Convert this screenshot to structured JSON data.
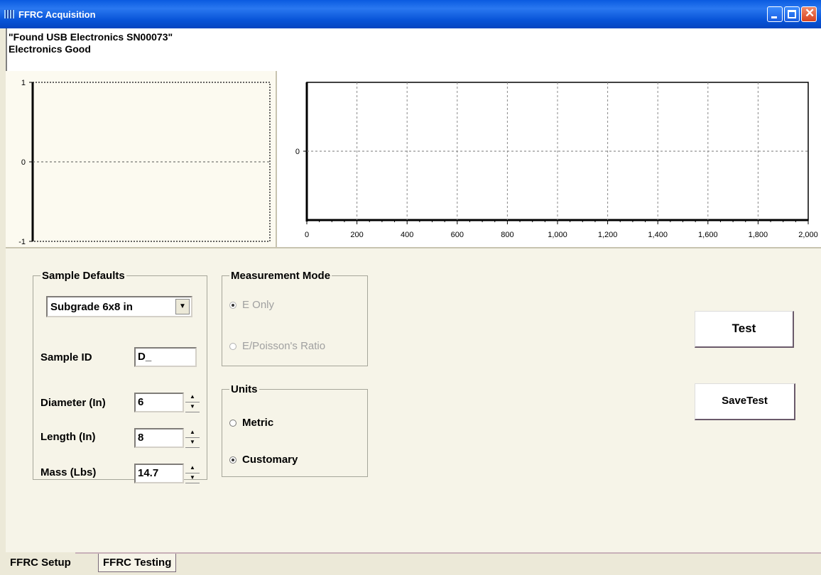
{
  "window": {
    "title": "FFRC Acquisition"
  },
  "status": {
    "line1": "\"Found USB Electronics SN00073\"",
    "line2": "Electronics Good"
  },
  "chart_data": [
    {
      "type": "line",
      "y_ticks": [
        "1",
        "0",
        "-1"
      ],
      "ylim": [
        -1,
        1
      ],
      "grid": "horizontal dashed at 0",
      "series": []
    },
    {
      "type": "line",
      "x_ticks": [
        "0",
        "200",
        "400",
        "600",
        "800",
        "1,000",
        "1,200",
        "1,400",
        "1,600",
        "1,800",
        "2,000"
      ],
      "xlim": [
        0,
        2000
      ],
      "y_ticks": [
        "0"
      ],
      "grid": "vertical dashed at each x tick, horizontal dashed at 0",
      "series": []
    }
  ],
  "sample_defaults": {
    "legend": "Sample Defaults",
    "preset_value": "Subgrade 6x8 in",
    "sample_id_label": "Sample ID",
    "sample_id_value": "D_",
    "diameter_label": "Diameter (In)",
    "diameter_value": "6",
    "length_label": "Length (In)",
    "length_value": "8",
    "mass_label": "Mass (Lbs)",
    "mass_value": "14.7"
  },
  "measurement_mode": {
    "legend": "Measurement Mode",
    "options": [
      {
        "label": "E Only",
        "checked": true,
        "enabled": false
      },
      {
        "label": "E/Poisson's Ratio",
        "checked": false,
        "enabled": false
      }
    ]
  },
  "units": {
    "legend": "Units",
    "options": [
      {
        "label": "Metric",
        "checked": false
      },
      {
        "label": "Customary",
        "checked": true
      }
    ]
  },
  "buttons": {
    "test": "Test",
    "save_test": "SaveTest"
  },
  "tabs": [
    {
      "label": "FFRC Setup",
      "active": true
    },
    {
      "label": "FFRC Testing",
      "active": false
    }
  ]
}
